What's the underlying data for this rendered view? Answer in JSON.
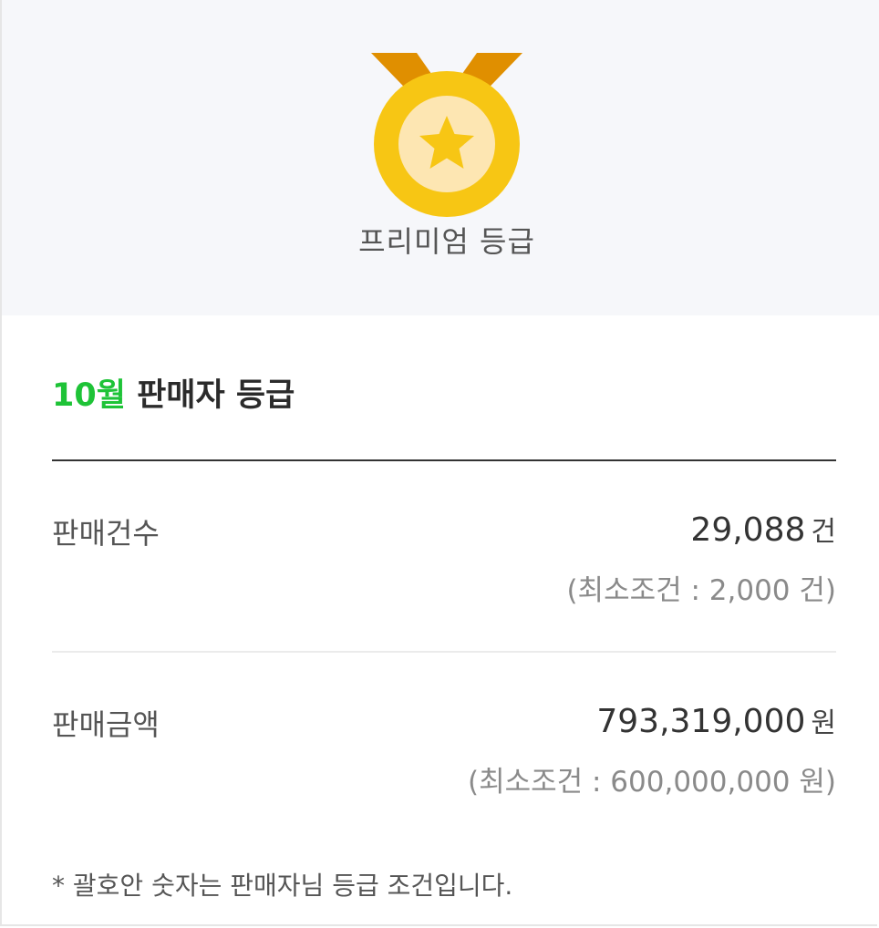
{
  "hero": {
    "medal_icon": "gold-medal-star-icon",
    "grade_label": "프리미엄 등급",
    "colors": {
      "ribbon": "#e08f00",
      "medal_outer": "#f7c614",
      "medal_inner": "#fde6b2",
      "star": "#f7c614",
      "background": "#f6f7fa"
    }
  },
  "section": {
    "month": "10월",
    "title": "판매자 등급",
    "month_color": "#1ec337"
  },
  "rows": [
    {
      "label": "판매건수",
      "value": "29,088",
      "unit": "건",
      "minimum": "(최소조건 : 2,000 건)"
    },
    {
      "label": "판매금액",
      "value": "793,319,000",
      "unit": "원",
      "minimum": "(최소조건 : 600,000,000 원)"
    }
  ],
  "footnote": "* 괄호안 숫자는 판매자님 등급 조건입니다."
}
